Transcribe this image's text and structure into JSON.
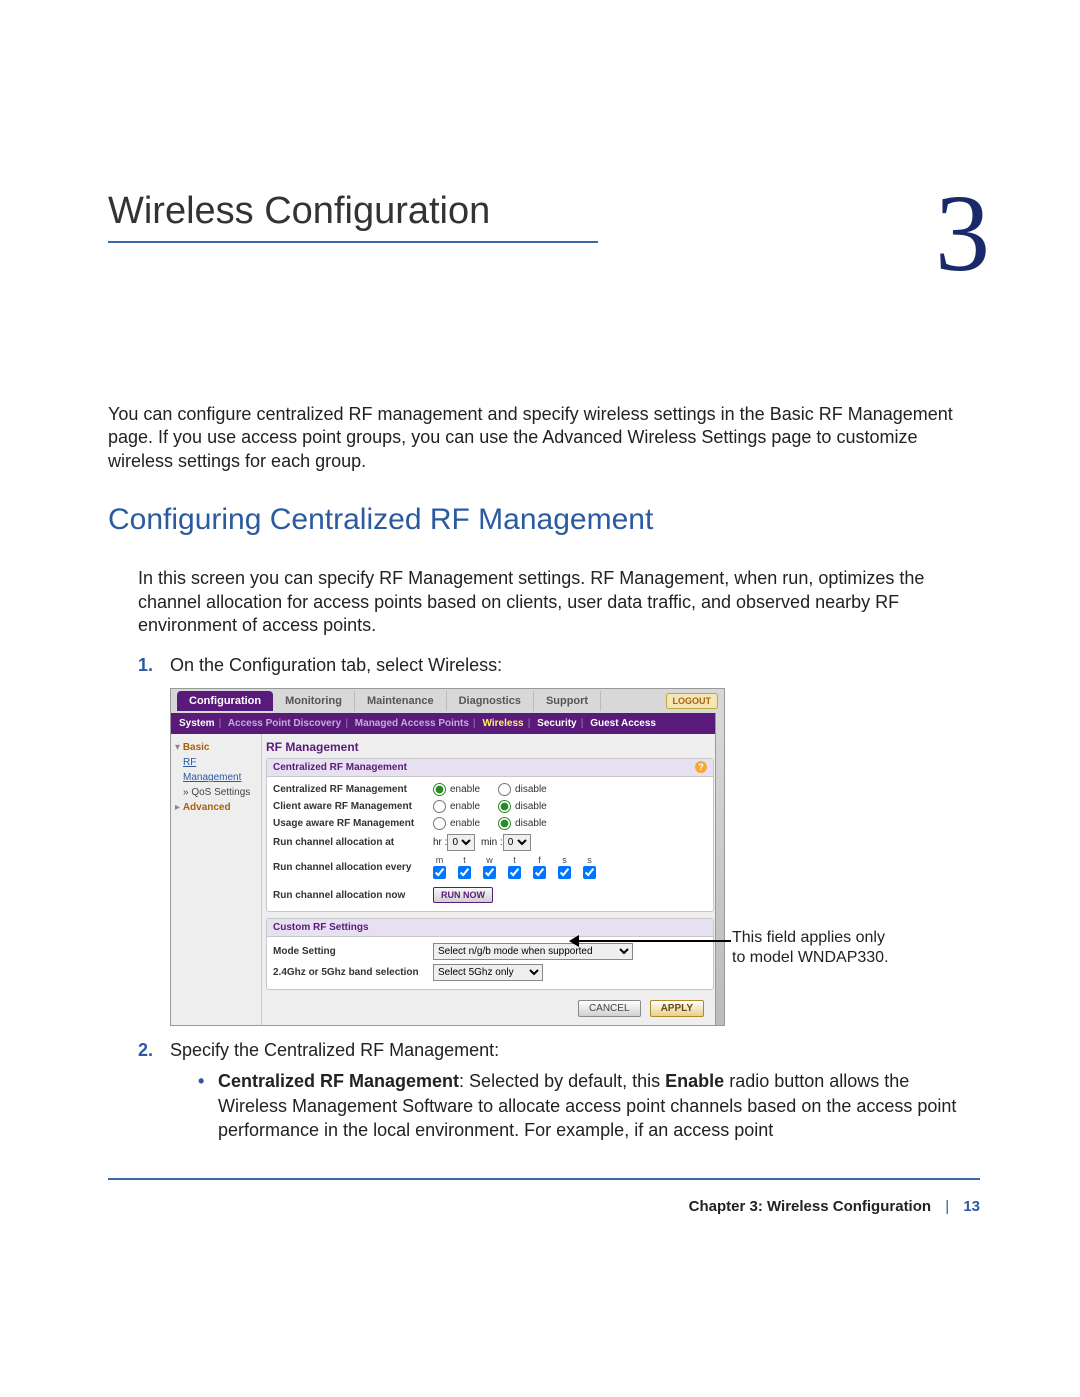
{
  "chapter": {
    "title": "Wireless Configuration",
    "number": "3"
  },
  "intro": "You can configure centralized RF management and specify wireless settings in the Basic RF Management page. If you use access point groups, you can use the Advanced Wireless Settings page to customize wireless settings for each group.",
  "section": {
    "title": "Configuring Centralized RF Management"
  },
  "section_para": "In this screen you can specify RF Management settings. RF Management, when run, optimizes the channel allocation for access points based on clients, user data traffic, and observed nearby RF environment of access points.",
  "steps": {
    "s1": "On the Configuration tab, select Wireless:",
    "s2": "Specify the Centralized RF Management:",
    "b1_bold1": "Centralized RF Management",
    "b1_mid": ": Selected by default, this ",
    "b1_bold2": "Enable",
    "b1_tail": " radio button allows the Wireless Management Software to allocate access point channels based on the access point performance in the local environment. For example, if an access point"
  },
  "annotation": "This field applies only to model WNDAP330.",
  "footer": {
    "chapter_label": "Chapter 3:  Wireless Configuration",
    "page": "13"
  },
  "app": {
    "tabs": [
      "Configuration",
      "Monitoring",
      "Maintenance",
      "Diagnostics",
      "Support"
    ],
    "logout": "LOGOUT",
    "subnav": [
      "System",
      "Access Point Discovery",
      "Managed Access Points",
      "Wireless",
      "Security",
      "Guest Access"
    ],
    "sidebar": {
      "basic": "Basic",
      "rf": "RF Management",
      "qos": "QoS Settings",
      "advanced": "Advanced"
    },
    "main_title": "RF Management",
    "panel1": {
      "title": "Centralized RF Management",
      "rows": {
        "crf": "Centralized RF Management",
        "carf": "Client aware RF Management",
        "uarf": "Usage aware RF Management",
        "runat": "Run channel allocation at",
        "runevery": "Run channel allocation every",
        "runnow": "Run channel allocation now"
      },
      "enable": "enable",
      "disable": "disable",
      "hr": "hr :",
      "min": "min :",
      "zero": "0",
      "days": [
        "m",
        "t",
        "w",
        "t",
        "f",
        "s",
        "s"
      ],
      "runnow_btn": "RUN NOW"
    },
    "panel2": {
      "title": "Custom RF Settings",
      "mode_lbl": "Mode Setting",
      "mode_val": "Select n/g/b mode when supported",
      "band_lbl": "2.4Ghz or 5Ghz band selection",
      "band_val": "Select 5Ghz only"
    },
    "buttons": {
      "cancel": "CANCEL",
      "apply": "APPLY"
    }
  }
}
